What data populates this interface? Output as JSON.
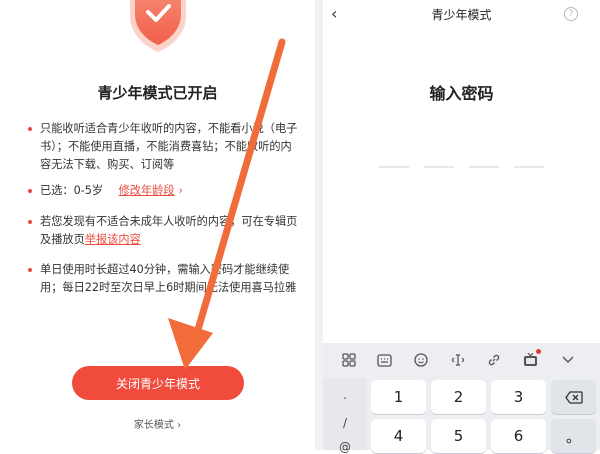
{
  "left_screen": {
    "title": "青少年模式已开启",
    "bullets": [
      {
        "text": "只能收听适合青少年收听的内容，不能看小说（电子书）；不能使用直播，不能消费喜钻；不能收听的内容无法下载、购买、订阅等"
      },
      {
        "prefix": "已选：0-5岁",
        "link": "修改年龄段",
        "chevron": "›"
      },
      {
        "prefix": "若您发现有不适合未成年人收听的内容，可在专辑页及播放页",
        "link": "举报该内容"
      },
      {
        "text": "单日使用时长超过40分钟，需输入密码才能继续使用；每日22时至次日早上6时期间无法使用喜马拉雅"
      }
    ],
    "close_button": "关闭青少年模式",
    "parent_mode": "家长模式 ›"
  },
  "right_screen": {
    "back": "‹",
    "title": "青少年模式",
    "help": "?",
    "heading": "输入密码",
    "keyboard": {
      "toolbar": [
        "apps-icon",
        "keyboard-icon",
        "emoji-icon",
        "cursor-icon",
        "link-icon",
        "tv-icon",
        "collapse-icon"
      ],
      "left_col": [
        ".",
        "/",
        "@"
      ],
      "row1": [
        "1",
        "2",
        "3"
      ],
      "row2": [
        "4",
        "5",
        "6"
      ],
      "backspace": "⌫",
      "dot": "。"
    }
  },
  "colors": {
    "accent": "#f04b3c",
    "shield": "#f47f6e",
    "link": "#e94b3c",
    "arrow": "#f26b3a"
  }
}
